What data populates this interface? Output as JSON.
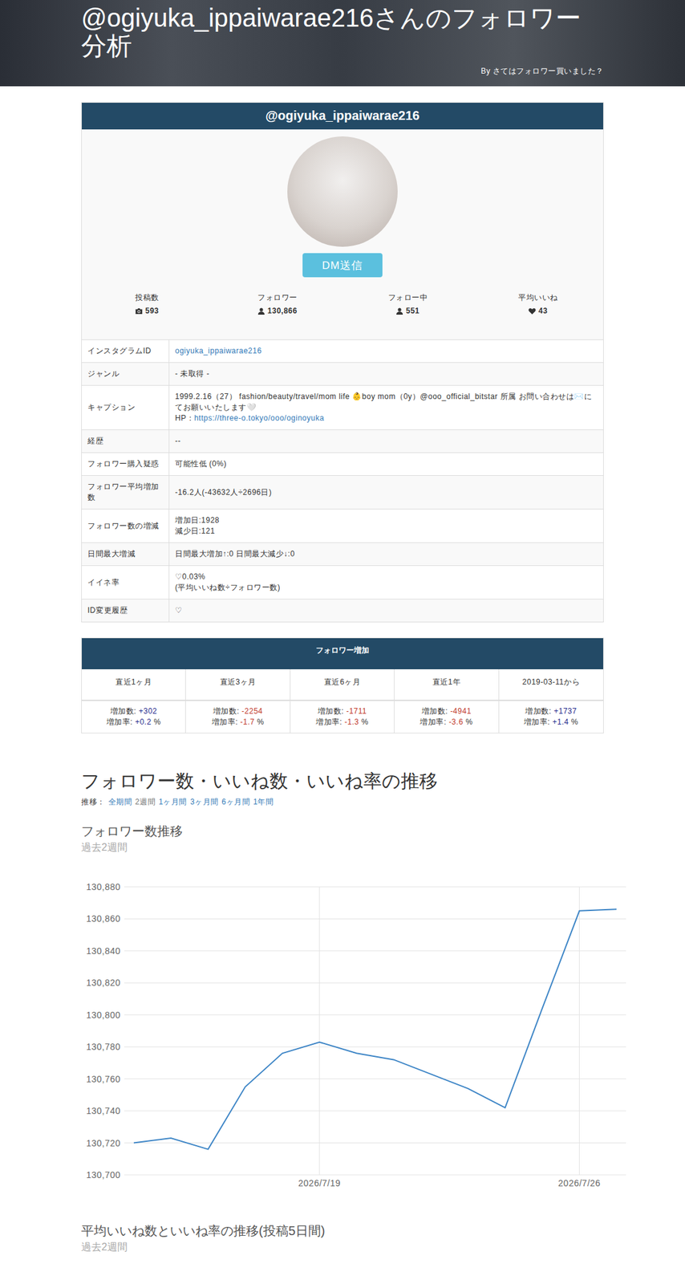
{
  "header": {
    "title": "@ogiyuka_ippaiwarae216さんのフォロワー分析",
    "byline": "By さてはフォロワー買いました？"
  },
  "profile": {
    "handle": "@ogiyuka_ippaiwarae216",
    "dm_button": "DM送信",
    "stats": [
      {
        "label": "投稿数",
        "value": "593",
        "kind": "camera"
      },
      {
        "label": "フォロワー",
        "value": "130,866",
        "kind": "person"
      },
      {
        "label": "フォロー中",
        "value": "551",
        "kind": "person"
      },
      {
        "label": "平均いいね",
        "value": "43",
        "kind": "heart"
      }
    ]
  },
  "info_rows": [
    {
      "label": "インスタグラムID",
      "kind": "link",
      "lines": [
        "ogiyuka_ippaiwarae216"
      ]
    },
    {
      "label": "ジャンル",
      "kind": "text",
      "lines": [
        "- 未取得 -"
      ]
    },
    {
      "label": "キャプション",
      "kind": "caption",
      "lines": [
        "1999.2.16（27） fashion/beauty/travel/mom life 👶boy mom（0y）@ooo_official_bitstar 所属 お問い合わせは✉️にてお願いいたします🤍"
      ],
      "hp_label": "HP：",
      "hp_link": "https://three-o.tokyo/ooo/oginoyuka"
    },
    {
      "label": "経歴",
      "kind": "text",
      "lines": [
        "--"
      ]
    },
    {
      "label": "フォロワー購入疑惑",
      "kind": "text",
      "lines": [
        "可能性低 (0%)"
      ]
    },
    {
      "label": "フォロワー平均増加数",
      "kind": "text",
      "lines": [
        "-16.2人(-43632人÷2696日)"
      ]
    },
    {
      "label": "フォロワー数の増減",
      "kind": "text",
      "lines": [
        "増加日:1928",
        "減少日:121"
      ]
    },
    {
      "label": "日間最大増減",
      "kind": "text",
      "lines": [
        "日間最大増加↑:0 日間最大減少↓:0"
      ]
    },
    {
      "label": "イイネ率",
      "kind": "text",
      "lines": [
        "♡0.03%",
        "(平均いいね数÷フォロワー数)"
      ]
    },
    {
      "label": "ID変更履歴",
      "kind": "text",
      "lines": [
        "♡"
      ]
    }
  ],
  "growth": {
    "title": "フォロワー増加",
    "count_label": "増加数:",
    "rate_label": "増加率:",
    "unit": "%",
    "columns": [
      {
        "period": "直近1ヶ月",
        "count": "+302",
        "rate": "+0.2",
        "color": "#1f2a8c"
      },
      {
        "period": "直近3ヶ月",
        "count": "-2254",
        "rate": "-1.7",
        "color": "#c0392b"
      },
      {
        "period": "直近6ヶ月",
        "count": "-1711",
        "rate": "-1.3",
        "color": "#c0392b"
      },
      {
        "period": "直近1年",
        "count": "-4941",
        "rate": "-3.6",
        "color": "#c0392b"
      },
      {
        "period": "2019-03-11から",
        "count": "+1737",
        "rate": "+1.4",
        "color": "#1f2a8c"
      }
    ]
  },
  "trends": {
    "heading": "フォロワー数・いいね数・いいね率の推移",
    "range_label": "推移：",
    "ranges": [
      {
        "label": "全期間",
        "selected": false
      },
      {
        "label": "2週間",
        "selected": true
      },
      {
        "label": "1ヶ月間",
        "selected": false
      },
      {
        "label": "3ヶ月間",
        "selected": false
      },
      {
        "label": "6ヶ月間",
        "selected": false
      },
      {
        "label": "1年間",
        "selected": false
      }
    ]
  },
  "follower_chart": {
    "title": "フォロワー数推移",
    "subtitle": "過去2週間",
    "y_ticks": [
      "130,880",
      "130,860",
      "130,840",
      "130,820",
      "130,800",
      "130,780",
      "130,760",
      "130,740",
      "130,720",
      "130,700"
    ],
    "x_ticks": [
      {
        "label": "2026/7/19",
        "at": 5
      },
      {
        "label": "2026/7/26",
        "at": 12
      }
    ],
    "values": [
      130720,
      130723,
      130716,
      130755,
      130776,
      130783,
      130776,
      130772,
      130763,
      130754,
      130742,
      130804,
      130865,
      130866
    ]
  },
  "likes_chart": {
    "title": "平均いいね数といいね率の推移(投稿5日間)",
    "subtitle": "過去2週間"
  }
}
